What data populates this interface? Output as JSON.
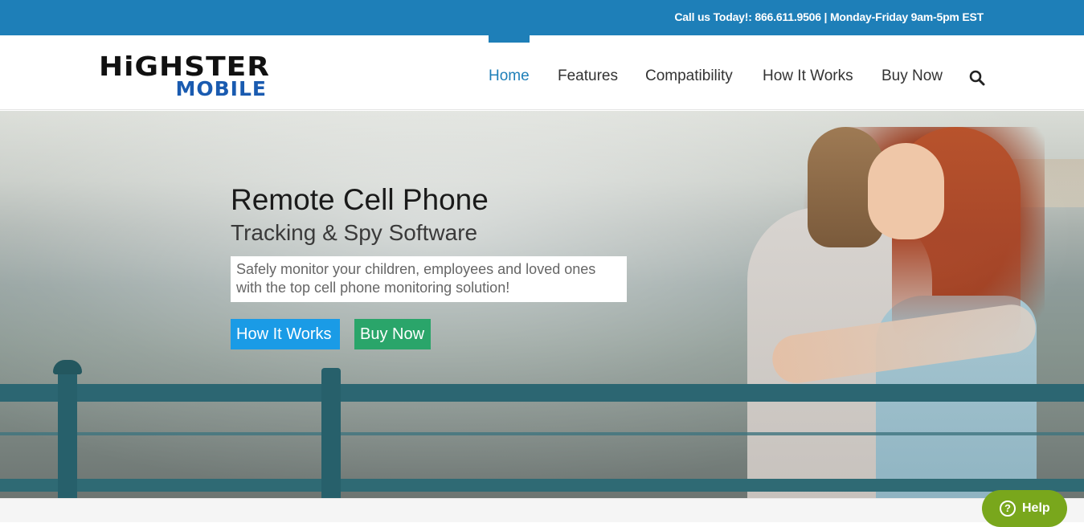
{
  "topbar": {
    "contact": "Call us Today!: 866.611.9506 | Monday-Friday 9am-5pm EST",
    "background": "#1e7fb8"
  },
  "logo": {
    "top": "HiGHSTER",
    "bottom": "MOBILE",
    "bottom_color": "#1a5bb0"
  },
  "nav": {
    "items": [
      {
        "label": "Home",
        "active": true
      },
      {
        "label": "Features",
        "active": false
      },
      {
        "label": "Compatibility",
        "active": false
      },
      {
        "label": "How It Works",
        "active": false
      },
      {
        "label": "Buy Now",
        "active": false
      }
    ],
    "search_icon": "search-icon",
    "accent": "#1e7fb8"
  },
  "hero": {
    "title": "Remote Cell Phone",
    "subtitle": "Tracking & Spy Software",
    "description": "Safely monitor your children, employees and loved ones with the top cell phone monitoring solution!",
    "buttons": {
      "how_it_works": "How It Works",
      "buy_now": "Buy Now"
    },
    "button_colors": {
      "how_it_works": "#1a9be6",
      "buy_now": "#2aa56a"
    }
  },
  "help": {
    "label": "Help",
    "icon": "question-circle-icon",
    "color": "#79a71c"
  }
}
